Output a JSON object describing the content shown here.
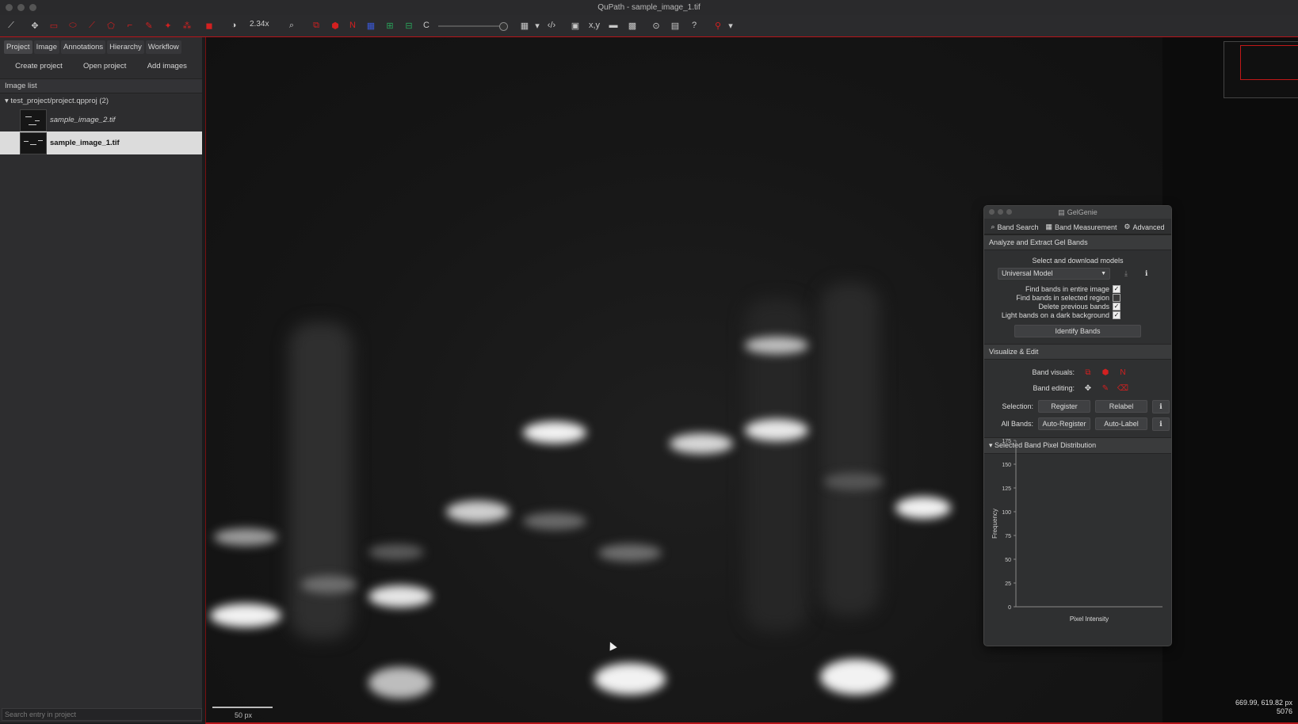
{
  "window": {
    "title": "QuPath - sample_image_1.tif"
  },
  "toolbar": {
    "zoom": "2.34x",
    "c_label": "C",
    "xy_label": "x,y"
  },
  "left_panel": {
    "tabs": [
      "Project",
      "Image",
      "Annotations",
      "Hierarchy",
      "Workflow"
    ],
    "buttons": {
      "create": "Create project",
      "open": "Open project",
      "add": "Add images"
    },
    "image_list_label": "Image list",
    "project_root": "test_project/project.qpproj (2)",
    "entries": [
      {
        "name": "sample_image_2.tif",
        "selected": false
      },
      {
        "name": "sample_image_1.tif",
        "selected": true
      }
    ],
    "search_placeholder": "Search entry in project"
  },
  "viewer": {
    "scale_label": "50 px",
    "coords_line1": "669.99, 619.82 px",
    "coords_line2": "5076"
  },
  "gelgenie": {
    "title": "GelGenie",
    "tabs": [
      "Band Search",
      "Band Measurement",
      "Advanced"
    ],
    "section1": "Analyze and Extract Gel Bands",
    "select_models_label": "Select and download models",
    "model": "Universal Model",
    "checkboxes": [
      {
        "label": "Find bands in entire image",
        "checked": true
      },
      {
        "label": "Find bands in selected region",
        "checked": false
      },
      {
        "label": "Delete previous bands",
        "checked": true
      },
      {
        "label": "Light bands on a dark background",
        "checked": true
      }
    ],
    "identify_button": "Identify Bands",
    "section2": "Visualize & Edit",
    "band_visuals_label": "Band visuals:",
    "band_editing_label": "Band editing:",
    "selection_label": "Selection:",
    "register_button": "Register",
    "relabel_button": "Relabel",
    "all_bands_label": "All Bands:",
    "auto_register_button": "Auto-Register",
    "auto_label_button": "Auto-Label",
    "section3": "Selected Band Pixel Distribution"
  },
  "chart_data": {
    "type": "bar",
    "title": "",
    "xlabel": "Pixel Intensity",
    "ylabel": "Frequency",
    "ylim": [
      0,
      175
    ],
    "yticks": [
      0,
      25,
      50,
      75,
      100,
      125,
      150,
      175
    ],
    "values": []
  },
  "colors": {
    "accent_red": "#d32020",
    "border_red": "#b7141a"
  }
}
